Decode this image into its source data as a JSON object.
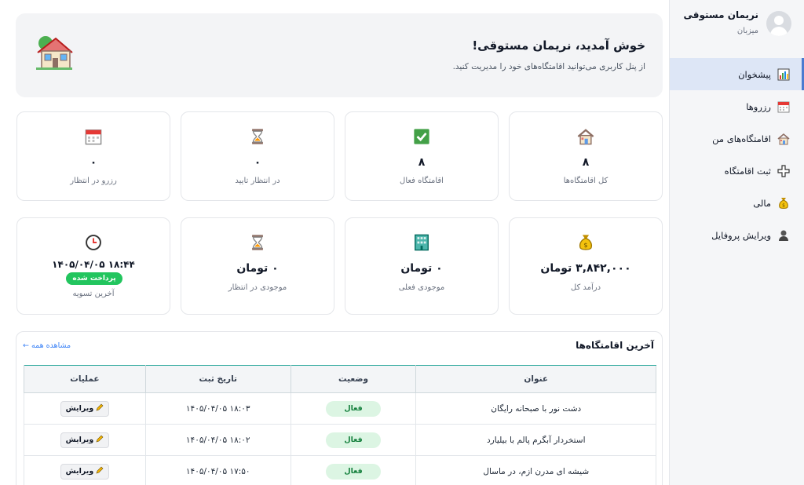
{
  "profile": {
    "name": "نریمان مستوقی",
    "role": "میزبان"
  },
  "nav": [
    {
      "label": "پیشخوان",
      "icon": "chart-icon",
      "active": true
    },
    {
      "label": "رزروها",
      "icon": "calendar-icon",
      "active": false
    },
    {
      "label": "اقامتگاه‌های من",
      "icon": "house-icon",
      "active": false
    },
    {
      "label": "ثبت اقامتگاه",
      "icon": "plus-icon",
      "active": false
    },
    {
      "label": "مالی",
      "icon": "money-bag-icon",
      "active": false
    },
    {
      "label": "ویرایش پروفایل",
      "icon": "user-icon",
      "active": false
    }
  ],
  "welcome": {
    "title": "خوش آمدید، نریمان مستوقی!",
    "subtitle": "از پنل کاربری می‌توانید اقامتگاه‌های خود را مدیریت کنید."
  },
  "stats_row1": [
    {
      "value": "۸",
      "label": "کل اقامتگاه‌ها",
      "icon": "house-icon"
    },
    {
      "value": "۸",
      "label": "اقامتگاه فعال",
      "icon": "check-icon"
    },
    {
      "value": "۰",
      "label": "در انتظار تایید",
      "icon": "hourglass-icon"
    },
    {
      "value": "۰",
      "label": "رزرو در انتظار",
      "icon": "calendar-icon"
    }
  ],
  "stats_row2": [
    {
      "value": "۳,۸۴۲,۰۰۰ تومان",
      "label": "درآمد کل",
      "icon": "money-bag-icon"
    },
    {
      "value": "۰ تومان",
      "label": "موجودی فعلی",
      "icon": "building-icon"
    },
    {
      "value": "۰ تومان",
      "label": "موجودی در انتظار",
      "icon": "hourglass-icon"
    },
    {
      "value": "۱۴۰۵/۰۴/۰۵ ۱۸:۴۴",
      "label": "آخرین تسویه",
      "badge": "پرداخت شده",
      "icon": "clock-icon"
    }
  ],
  "panel": {
    "title": "آخرین اقامتگاه‌ها",
    "view_all": "مشاهده همه ←",
    "columns": [
      "عنوان",
      "وضعیت",
      "تاریخ ثبت",
      "عملیات"
    ],
    "rows": [
      {
        "title": "دشت نور با صبحانه رایگان",
        "status": "فعال",
        "date": "۱۴۰۵/۰۴/۰۵ ۱۸:۰۳",
        "action": "ویرایش"
      },
      {
        "title": "استخردار آبگرم پالم با بیلیارد",
        "status": "فعال",
        "date": "۱۴۰۵/۰۴/۰۵ ۱۸:۰۲",
        "action": "ویرایش"
      },
      {
        "title": "شیشه ای مدرن ازم، در ماسال",
        "status": "فعال",
        "date": "۱۴۰۵/۰۴/۰۵ ۱۷:۵۰",
        "action": "ویرایش"
      }
    ]
  },
  "colors": {
    "accent": "#4a7bd0",
    "active_bg": "#dde6f6",
    "success": "#22c55e",
    "table_border": "#26a69a"
  }
}
